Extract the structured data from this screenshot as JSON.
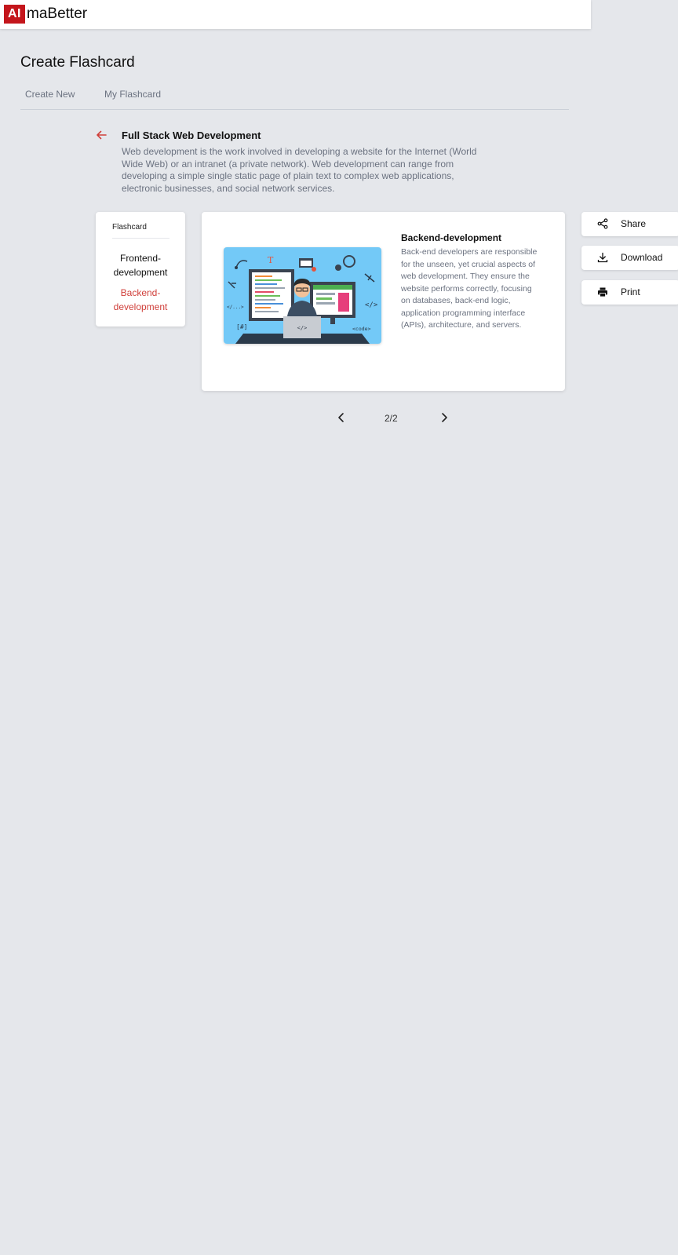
{
  "header": {
    "logo_mark": "AI",
    "logo_text": "maBetter",
    "brand_color": "#c4161c"
  },
  "page": {
    "title": "Create Flashcard",
    "tabs": [
      {
        "label": "Create New"
      },
      {
        "label": "My Flashcard"
      }
    ]
  },
  "course": {
    "back_icon": "arrow-left-icon",
    "title": "Full Stack Web Development",
    "description": "Web development is the work involved in developing a website for the Internet (World Wide Web) or an intranet (a private network). Web development can range from developing a simple single static page of plain text to complex web applications, electronic businesses, and social network services."
  },
  "sidebar": {
    "heading": "Flashcard",
    "items": [
      {
        "label": "Frontend-development",
        "active": false
      },
      {
        "label": "Backend-development",
        "active": true
      }
    ],
    "active_color": "#d0403b"
  },
  "card": {
    "title": "Backend-development",
    "body": "Back-end developers are responsible for the unseen, yet crucial aspects of web development. They ensure the website performs correctly, focusing on databases, back-end logic, application programming interface (APIs), architecture, and servers.",
    "illustration": {
      "labels": [
        "</...>",
        "</>",
        "[#]",
        "<code>",
        "</>",
        "T"
      ]
    }
  },
  "actions": [
    {
      "label": "Share",
      "icon": "share-icon"
    },
    {
      "label": "Download",
      "icon": "download-icon"
    },
    {
      "label": "Print",
      "icon": "print-icon"
    }
  ],
  "pagination": {
    "current": "2/2",
    "prev_icon": "chevron-left-icon",
    "next_icon": "chevron-right-icon"
  }
}
